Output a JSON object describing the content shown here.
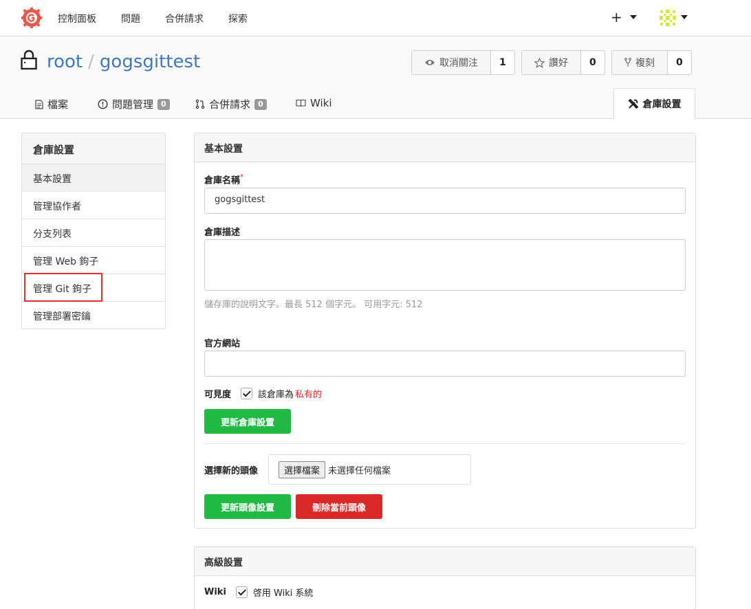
{
  "nav": {
    "items": [
      "控制面板",
      "問題",
      "合併請求",
      "探索"
    ],
    "plus": "+"
  },
  "repo": {
    "owner": "root",
    "separator": "/",
    "name": "gogsgittest",
    "watch": {
      "label": "取消關注",
      "count": "1"
    },
    "star": {
      "label": "讚好",
      "count": "0"
    },
    "fork": {
      "label": "複刻",
      "count": "0"
    }
  },
  "tabs": {
    "files": "檔案",
    "issues": {
      "label": "問題管理",
      "count": "0"
    },
    "pulls": {
      "label": "合併請求",
      "count": "0"
    },
    "wiki": "Wiki",
    "settings": "倉庫設置"
  },
  "sidebar": {
    "title": "倉庫設置",
    "items": [
      "基本設置",
      "管理協作者",
      "分支列表",
      "管理 Web 鉤子",
      "管理 Git 鉤子",
      "管理部署密鑰"
    ]
  },
  "basic": {
    "title": "基本設置",
    "name_label": "倉庫名稱",
    "required_mark": "*",
    "name_value": "gogsgittest",
    "desc_label": "倉庫描述",
    "desc_hint": "儲存庫的說明文字。最長 512 個字元。 可用字元: 512",
    "website_label": "官方網站",
    "visibility_label": "可見度",
    "visibility_text": "該倉庫為",
    "visibility_value": "私有的",
    "update_button": "更新倉庫設置",
    "avatar_label": "選擇新的頭像",
    "file_button": "選擇檔案",
    "file_none": "未選擇任何檔案",
    "update_avatar_button": "更新頭像設置",
    "delete_avatar_button": "刪除當前頭像"
  },
  "advanced": {
    "title": "高級設置",
    "wiki_label": "Wiki",
    "wiki_enable": "啓用 Wiki 系統"
  },
  "colors": {
    "link": "#4078c0",
    "green": "#21ba45",
    "red": "#db2828",
    "logo": "#e8594c"
  }
}
